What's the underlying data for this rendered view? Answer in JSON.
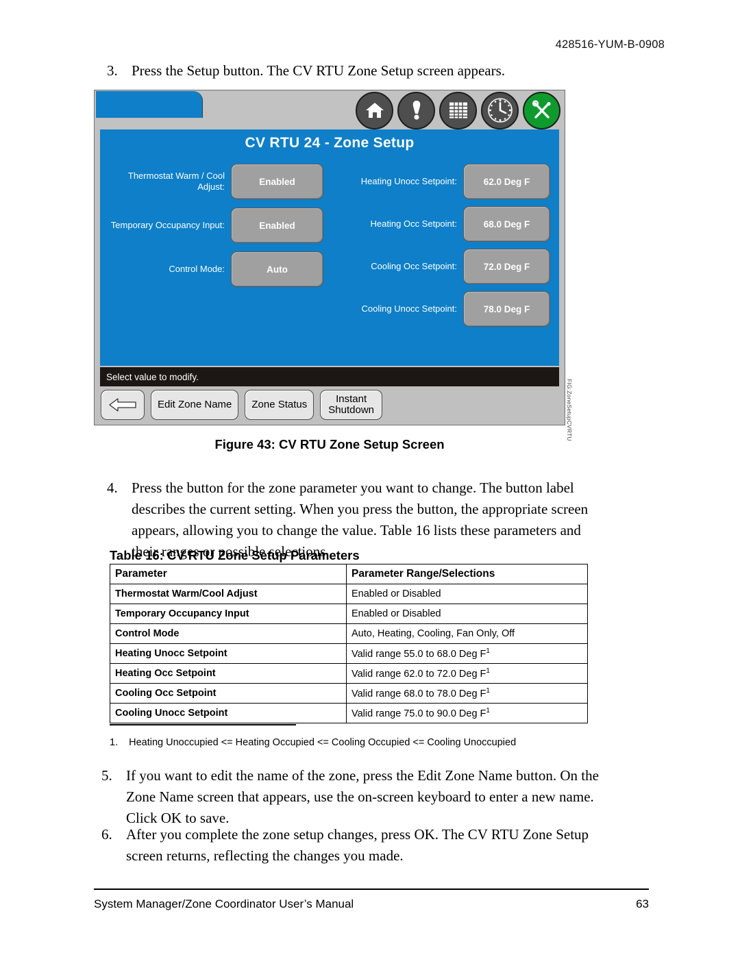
{
  "page": {
    "header_code": "428516-YUM-B-0908",
    "footer_title": "System Manager/Zone Coordinator User’s Manual",
    "footer_page": "63"
  },
  "steps": {
    "step3": {
      "num": "3.",
      "text": "Press the Setup button. The CV RTU Zone Setup screen appears."
    },
    "step4": {
      "num": "4.",
      "text": "Press the button for the zone parameter you want to change. The button label describes the current setting. When you press the button, the appropriate screen appears, allowing you to change the value. Table 16 lists these parameters and their ranges or possible selections."
    },
    "step5": {
      "num": "5.",
      "text": "If you want to edit the name of the zone, press the Edit Zone Name button. On the Zone Name screen that appears, use the on-screen keyboard to enter a new name. Click OK to save."
    },
    "step6": {
      "num": "6.",
      "text": "After you complete the zone setup changes, press OK. The CV RTU Zone Setup screen returns, reflecting the changes you made."
    }
  },
  "figure": {
    "caption": "Figure 43: CV RTU Zone Setup Screen",
    "code": "FIG:ZoneSetupCVRTU",
    "screen_title": "CV RTU 24 - Zone Setup",
    "status_text": "Select value to modify.",
    "toolbar_icons": [
      {
        "name": "home-icon",
        "label": "Home"
      },
      {
        "name": "alarm-icon",
        "label": "Alarms"
      },
      {
        "name": "schedule-table-icon",
        "label": "Schedules"
      },
      {
        "name": "clock-icon",
        "label": "Time"
      },
      {
        "name": "tools-icon",
        "label": "Setup"
      }
    ],
    "left_fields": [
      {
        "label": "Thermostat Warm / Cool Adjust:",
        "value": "Enabled"
      },
      {
        "label": "Temporary Occupancy Input:",
        "value": "Enabled"
      },
      {
        "label": "Control Mode:",
        "value": "Auto"
      }
    ],
    "right_fields": [
      {
        "label": "Heating Unocc Setpoint:",
        "value": "62.0 Deg F"
      },
      {
        "label": "Heating Occ Setpoint:",
        "value": "68.0 Deg F"
      },
      {
        "label": "Cooling Occ Setpoint:",
        "value": "72.0 Deg F"
      },
      {
        "label": "Cooling Unocc Setpoint:",
        "value": "78.0 Deg F"
      }
    ],
    "bottom_buttons": [
      {
        "name": "back-button",
        "label": ""
      },
      {
        "name": "edit-zone-name-button",
        "label": "Edit Zone Name"
      },
      {
        "name": "zone-status-button",
        "label": "Zone Status"
      },
      {
        "name": "instant-shutdown-button",
        "label": "Instant\nShutdown"
      }
    ]
  },
  "table": {
    "title": "Table 16: CV RTU Zone Setup Parameters",
    "columns": [
      "Parameter",
      "Parameter Range/Selections"
    ],
    "rows": [
      {
        "parameter": "Thermostat Warm/Cool Adjust",
        "range": "Enabled or Disabled",
        "footnote": ""
      },
      {
        "parameter": "Temporary Occupancy Input",
        "range": "Enabled or Disabled",
        "footnote": ""
      },
      {
        "parameter": "Control Mode",
        "range": "Auto, Heating, Cooling, Fan Only, Off",
        "footnote": ""
      },
      {
        "parameter": "Heating Unocc Setpoint",
        "range": "Valid range 55.0 to 68.0 Deg F",
        "footnote": "1"
      },
      {
        "parameter": "Heating Occ Setpoint",
        "range": "Valid range 62.0 to 72.0 Deg F",
        "footnote": "1"
      },
      {
        "parameter": "Cooling Occ Setpoint",
        "range": "Valid range 68.0 to 78.0 Deg F",
        "footnote": "1"
      },
      {
        "parameter": "Cooling Unocc Setpoint",
        "range": "Valid range 75.0 to 90.0 Deg F",
        "footnote": "1"
      }
    ]
  },
  "footnote": {
    "num": "1.",
    "text": "Heating Unoccupied <= Heating Occupied <= Cooling Occupied <= Cooling Unoccupied"
  },
  "colors": {
    "screen_blue": "#0e7fc8",
    "button_gray": "#a0a0a0",
    "tools_green": "#0f9a2e"
  }
}
